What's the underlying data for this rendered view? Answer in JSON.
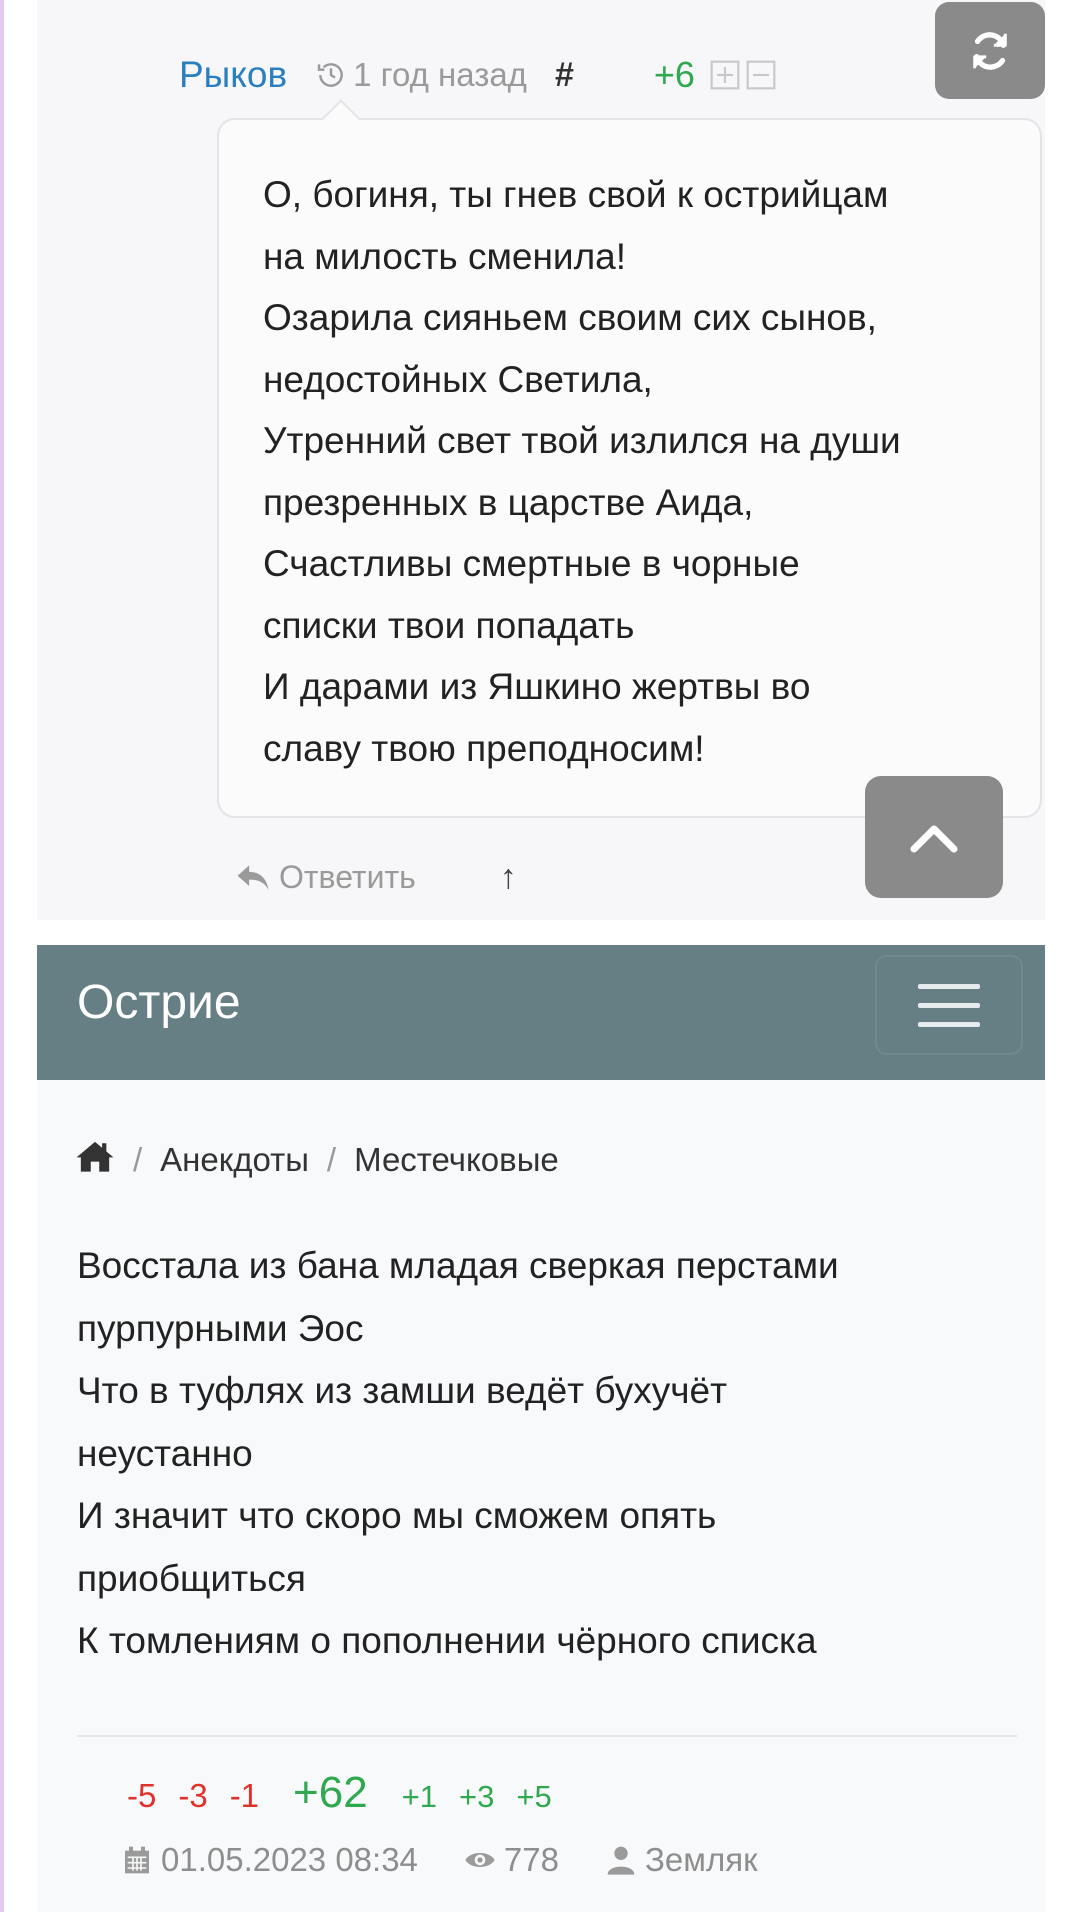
{
  "comment": {
    "author": "Рыков",
    "time": "1 год назад",
    "hash": "#",
    "score": "+6",
    "lines": [
      "О, богиня, ты гнев свой к острийцам",
      "на милость сменила!",
      "Озарила сияньем своим сих сынов,",
      "недостойных Светила,",
      "Утренний свет твой излился на души",
      "презренных в царстве Аида,",
      "Счастливы смертные в чорные",
      "списки твои попадать",
      "И дарами из Яшкино жертвы во",
      "славу твою преподносим!"
    ],
    "reply_label": "Ответить",
    "up_arrow": "↑"
  },
  "navbar": {
    "brand": "Острие"
  },
  "breadcrumb": {
    "sep": "/",
    "items": [
      "Анекдоты",
      "Местечковые"
    ]
  },
  "post": {
    "lines": [
      "Восстала из бана младая сверкая перстами",
      "пурпурными Эос",
      "Что в туфлях из замши ведёт бухучёт",
      "неустанно",
      "И значит что скоро мы сможем опять",
      "приобщиться",
      "К томлениям о пополнении чёрного списка"
    ],
    "votes": {
      "neg": [
        "-5",
        "-3",
        "-1"
      ],
      "total": "+62",
      "pos": [
        "+1",
        "+3",
        "+5"
      ]
    },
    "date": "01.05.2023 08:34",
    "views": "778",
    "author": "Земляк"
  },
  "icons": {
    "history": "history-icon",
    "expand": "expand-icon",
    "collapse": "collapse-icon",
    "refresh": "refresh-icon",
    "scroll_top": "chevron-up-icon",
    "reply": "reply-icon",
    "home": "home-icon",
    "calendar": "calendar-icon",
    "views": "eye-icon",
    "user": "user-icon"
  },
  "colors": {
    "author_link": "#2a7fc0",
    "positive": "#2fa84f",
    "negative": "#e0322b",
    "navbar_bg": "#657f85",
    "floating_button": "#8a8a8a"
  }
}
